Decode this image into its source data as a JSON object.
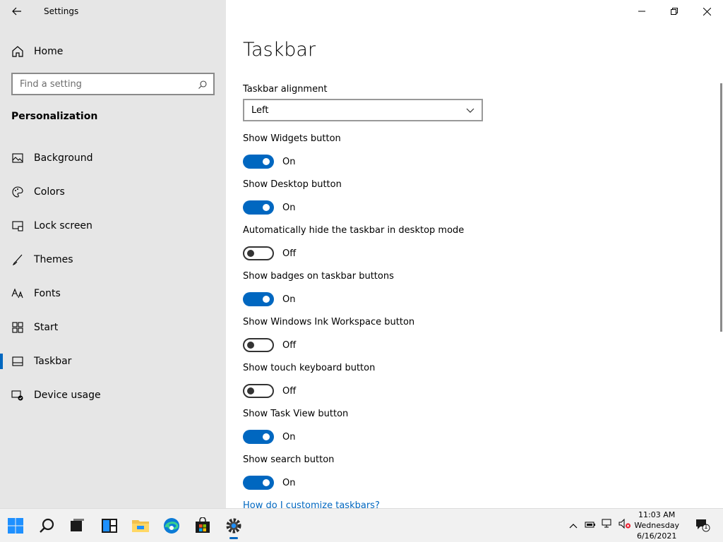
{
  "window": {
    "title": "Settings"
  },
  "sidebar": {
    "home_label": "Home",
    "search_placeholder": "Find a setting",
    "section": "Personalization",
    "items": [
      {
        "label": "Background",
        "icon": "image-icon"
      },
      {
        "label": "Colors",
        "icon": "palette-icon"
      },
      {
        "label": "Lock screen",
        "icon": "lock-screen-icon"
      },
      {
        "label": "Themes",
        "icon": "brush-icon"
      },
      {
        "label": "Fonts",
        "icon": "fonts-icon"
      },
      {
        "label": "Start",
        "icon": "start-icon"
      },
      {
        "label": "Taskbar",
        "icon": "taskbar-icon",
        "selected": true
      },
      {
        "label": "Device usage",
        "icon": "device-usage-icon"
      }
    ]
  },
  "main": {
    "title": "Taskbar",
    "alignment_label": "Taskbar alignment",
    "alignment_value": "Left",
    "settings": [
      {
        "label": "Show Widgets button",
        "state": "On"
      },
      {
        "label": "Show Desktop button",
        "state": "On"
      },
      {
        "label": "Automatically hide the taskbar in desktop mode",
        "state": "Off"
      },
      {
        "label": "Show badges on taskbar buttons",
        "state": "On"
      },
      {
        "label": "Show Windows Ink Workspace button",
        "state": "Off"
      },
      {
        "label": "Show touch keyboard button",
        "state": "Off"
      },
      {
        "label": "Show Task View button",
        "state": "On"
      },
      {
        "label": "Show search button",
        "state": "On"
      }
    ],
    "help_link": "How do I customize taskbars?"
  },
  "taskbar": {
    "apps": [
      "start-icon",
      "search-icon",
      "task-view-icon",
      "widgets-icon",
      "file-explorer-icon",
      "edge-icon",
      "store-icon",
      "settings-icon"
    ],
    "clock": {
      "time": "11:03 AM",
      "day": "Wednesday",
      "date": "6/16/2021"
    },
    "notification_count": "1"
  },
  "colors": {
    "accent": "#0067c0",
    "sidebar_bg": "#e6e6e6",
    "taskbar_bg": "#f1f1f1"
  }
}
